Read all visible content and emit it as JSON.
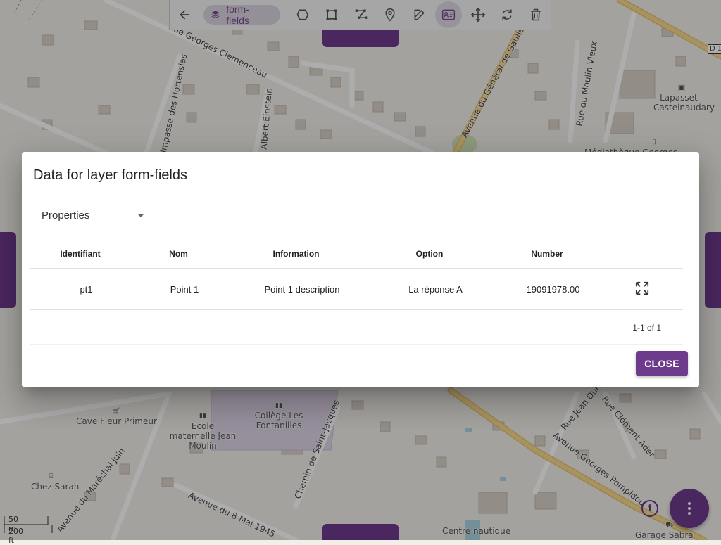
{
  "toolbar": {
    "back_icon": "arrow-left-icon",
    "layer_chip_label": "form-fields",
    "tools": [
      {
        "icon": "polygon-icon"
      },
      {
        "icon": "rectangle-icon"
      },
      {
        "icon": "line-icon"
      },
      {
        "icon": "marker-icon"
      },
      {
        "icon": "edit-icon"
      },
      {
        "icon": "data-table-icon",
        "active": true
      },
      {
        "icon": "move-icon"
      },
      {
        "icon": "rotate-icon"
      },
      {
        "icon": "delete-icon"
      }
    ]
  },
  "dialog": {
    "title": "Data for layer form-fields",
    "view_select": "Properties",
    "columns": [
      "Identifiant",
      "Nom",
      "Information",
      "Option",
      "Number"
    ],
    "rows": [
      [
        "pt1",
        "Point 1",
        "Point 1 description",
        "La réponse A",
        "19091978.00"
      ]
    ],
    "pagination": "1-1 of 1",
    "close_label": "CLOSE"
  },
  "map": {
    "labels": {
      "clemenceau": "Rue Georges Clemenceau",
      "hortensias": "Impasse des Hortensias",
      "einstein": "Rue Albert Einstein",
      "general_gaulle": "Avenue du Général de Gaulle",
      "moulin_vieux": "Rue du Moulin Vieux",
      "lapasset": "Lapasset - Castelnaudary",
      "mediatheque": "Médiathèque Georges",
      "d1": "D 1",
      "cave": "Cave Fleur Primeur",
      "ecole": "École maternelle Jean Moulin",
      "college": "Collège Les Fontanilles",
      "saint_jacques": "Chemin de Saint-Jacques",
      "jean_dura": "Rue Jean Dura",
      "clement_ader": "Rue Clément Ader",
      "pompidou": "Avenue Georges Pompidou",
      "marechal_juin": "Avenue du Maréchal Juin",
      "huit_mai": "Avenue du 8 Mai 1945",
      "chez_sarah": "Chez Sarah",
      "centre_nautique": "Centre nautique",
      "garage_sabra": "Garage Sabra"
    },
    "scale": {
      "metric": "50 m",
      "imperial": "200 ft"
    }
  },
  "colors": {
    "accent": "#6e3a8c",
    "road_major": "#f7d27a"
  }
}
